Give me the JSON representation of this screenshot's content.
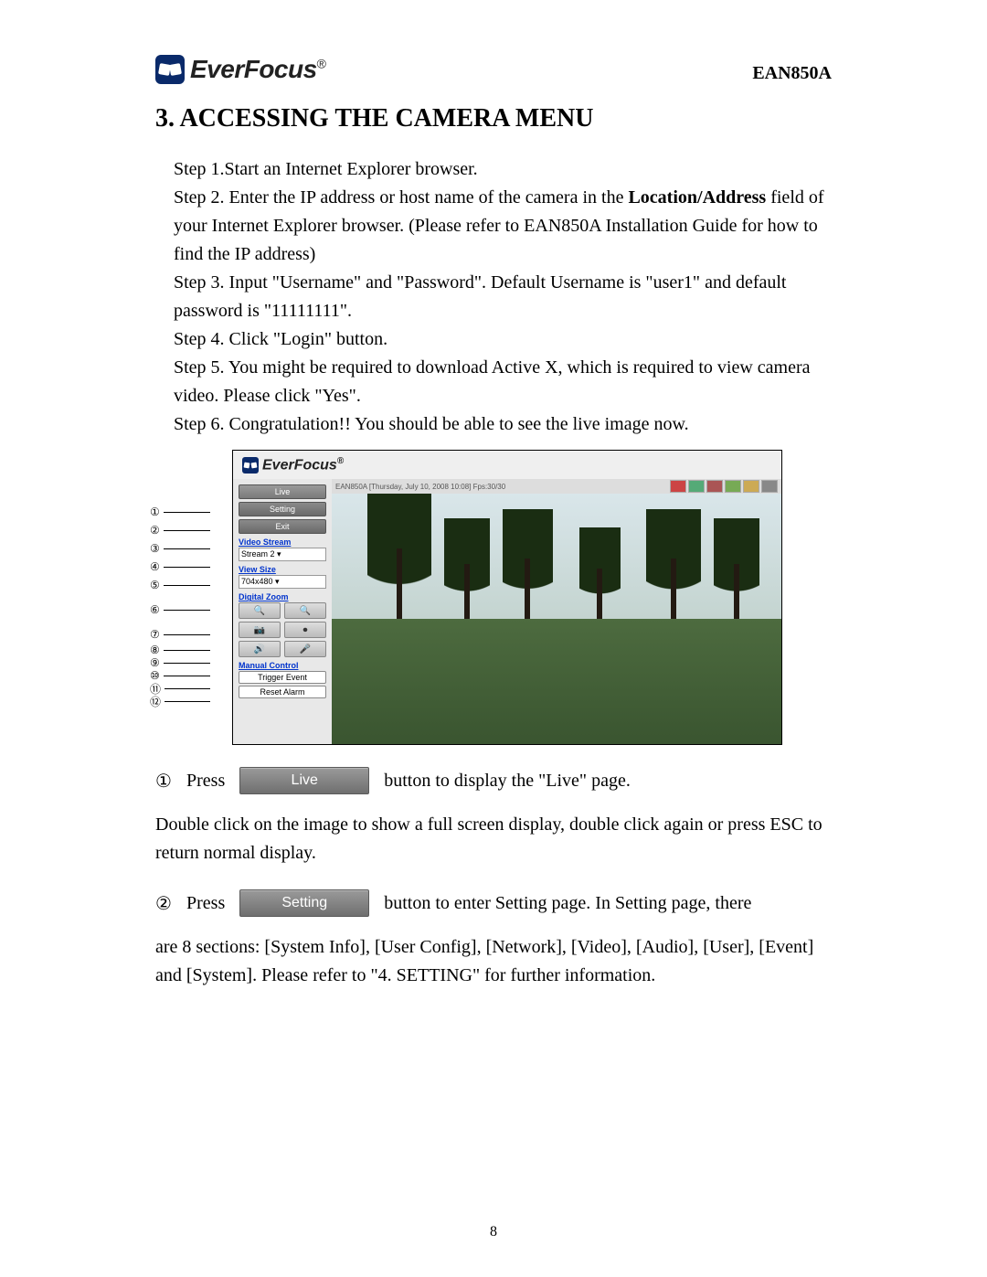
{
  "header": {
    "brand": "EverFocus",
    "model": "EAN850A"
  },
  "section_title": "3. ACCESSING THE CAMERA MENU",
  "steps": {
    "s1": "Step 1.Start an Internet Explorer browser.",
    "s2a": "Step 2. Enter the IP address or host name of the camera in the ",
    "s2b": "Location/Address",
    "s2c": " field of your Internet Explorer browser. (Please refer to EAN850A Installation Guide for how to find the IP address)",
    "s3": "Step 3. Input \"Username\" and \"Password\". Default Username is \"user1\" and default password is \"11111111\".",
    "s4": "Step 4. Click \"Login\" button.",
    "s5": "Step 5. You might be required to download Active X, which is required to view camera video. Please click \"Yes\".",
    "s6": "Step 6. Congratulation!! You should be able to see the live image now."
  },
  "figure": {
    "brand": "EverFocus",
    "status_text": "EAN850A [Thursday, July 10, 2008 10:08] Fps:30/30",
    "sidebar": {
      "live": "Live",
      "setting": "Setting",
      "exit": "Exit",
      "video_stream_label": "Video Stream",
      "video_stream_value": "Stream 2",
      "view_size_label": "View Size",
      "view_size_value": "704x480",
      "digital_zoom_label": "Digital Zoom",
      "manual_control_label": "Manual Control",
      "trigger_event": "Trigger Event",
      "reset_alarm": "Reset Alarm"
    }
  },
  "press_live": {
    "bullet": "①",
    "press": "Press",
    "button_label": "Live",
    "after": "button to display the \"Live\" page."
  },
  "double_click_text": "Double click on the image to show a full screen display, double click again or press ESC to return normal display.",
  "press_setting": {
    "bullet": "②",
    "press": "Press",
    "button_label": "Setting",
    "after": "button to enter Setting page. In Setting page, there"
  },
  "sections_text": "are 8 sections: [System Info], [User Config], [Network], [Video], [Audio], [User], [Event] and [System]. Please refer to \"4. SETTING\" for further information.",
  "page_number": "8"
}
